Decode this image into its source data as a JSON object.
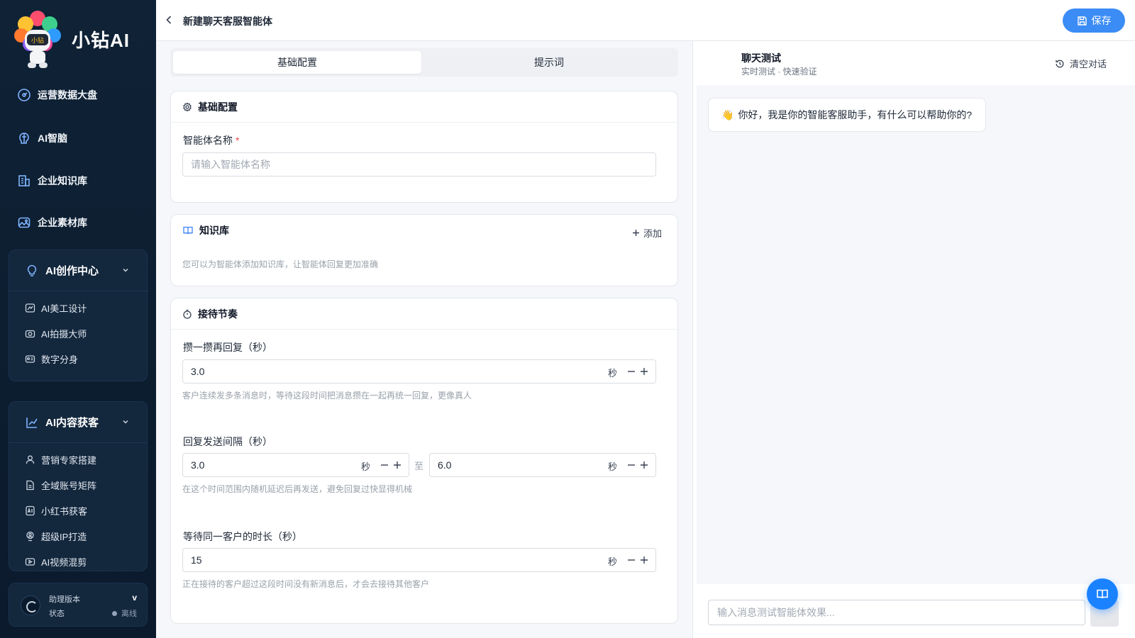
{
  "brand": {
    "name": "小钻AI",
    "logo_text": "小钻"
  },
  "sidebar": {
    "items": [
      {
        "label": "运营数据大盘",
        "icon": "dashboard-icon"
      },
      {
        "label": "AI智脑",
        "icon": "brain-icon"
      },
      {
        "label": "企业知识库",
        "icon": "building-icon"
      },
      {
        "label": "企业素材库",
        "icon": "image-icon"
      }
    ],
    "groups": [
      {
        "label": "AI创作中心",
        "icon": "bulb-icon",
        "expanded": true,
        "items": [
          {
            "label": "AI美工设计",
            "icon": "design-icon"
          },
          {
            "label": "AI拍摄大师",
            "icon": "camera-icon"
          },
          {
            "label": "数字分身",
            "icon": "id-card-icon"
          }
        ]
      },
      {
        "label": "AI内容获客",
        "icon": "chart-icon",
        "expanded": true,
        "items": [
          {
            "label": "营销专家搭建",
            "icon": "user-icon"
          },
          {
            "label": "全域账号矩阵",
            "icon": "file-icon"
          },
          {
            "label": "小红书获客",
            "icon": "ai-badge-icon"
          },
          {
            "label": "超级IP打造",
            "icon": "ip-icon"
          },
          {
            "label": "AI视频混剪",
            "icon": "video-icon"
          }
        ]
      }
    ],
    "version": {
      "label": "助理版本",
      "value": "v",
      "status_label": "状态",
      "status": "离线"
    }
  },
  "header": {
    "title": "新建聊天客服智能体",
    "save_label": "保存"
  },
  "tabs": [
    {
      "label": "基础配置",
      "active": true
    },
    {
      "label": "提示词",
      "active": false
    }
  ],
  "basic": {
    "title": "基础配置",
    "name_label": "智能体名称",
    "required_mark": "*",
    "name_placeholder": "请输入智能体名称",
    "name_value": ""
  },
  "knowledge": {
    "title": "知识库",
    "add_label": "添加",
    "hint": "您可以为智能体添加知识库，让智能体回复更加准确"
  },
  "rhythm": {
    "title": "接待节奏",
    "merge": {
      "label": "攒一攒再回复（秒）",
      "value": "3.0",
      "unit": "秒",
      "help": "客户连续发多条消息时，等待这段时间把消息攒在一起再统一回复，更像真人"
    },
    "interval": {
      "label": "回复发送间隔（秒）",
      "min": "3.0",
      "max": "6.0",
      "unit": "秒",
      "separator": "至",
      "help": "在这个时间范围内随机延迟后再发送，避免回复过快显得机械"
    },
    "wait": {
      "label": "等待同一客户的时长（秒）",
      "value": "15",
      "unit": "秒",
      "help": "正在接待的客户超过这段时间没有新消息后，才会去接待其他客户"
    }
  },
  "chat": {
    "title": "聊天测试",
    "subtitle": "实时测试 · 快速验证",
    "clear_label": "清空对话",
    "greeting_emoji": "👋",
    "greeting": "你好，我是你的智能客服助手，有什么可以帮助你的?",
    "input_placeholder": "输入消息测试智能体效果..."
  },
  "colors": {
    "sidebar_bg": "#0f2236",
    "accent": "#3b8cf5",
    "fab": "#1a82ff",
    "required": "#ef4444"
  }
}
